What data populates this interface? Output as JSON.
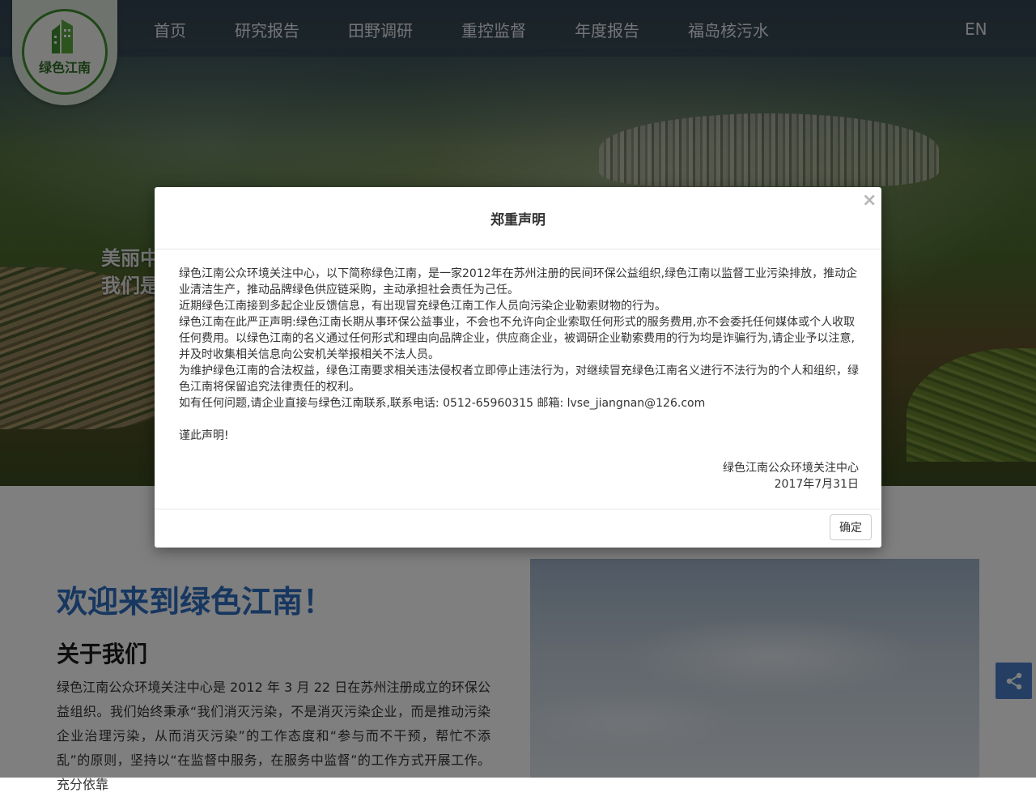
{
  "nav": {
    "logo_text": "绿色江南",
    "items": [
      "首页",
      "研究报告",
      "田野调研",
      "重控监督",
      "年度报告",
      "福岛核污水"
    ],
    "lang": "EN"
  },
  "hero": {
    "caption_line1": "美丽中",
    "caption_line2": "我们是"
  },
  "main": {
    "welcome": "欢迎来到绿色江南！",
    "about_title": "关于我们",
    "about_text": "绿色江南公众环境关注中心是 2012 年 3 月 22 日在苏州注册成立的环保公益组织。我们始终秉承“我们消灭污染，不是消灭污染企业，而是推动污染企业治理污染，从而消灭污染”的工作态度和“参与而不干预，帮忙不添乱”的原则，坚持以“在监督中服务，在服务中监督”的工作方式开展工作。充分依靠"
  },
  "modal": {
    "title": "郑重声明",
    "close": "×",
    "paragraphs": [
      "绿色江南公众环境关注中心，以下简称绿色江南，是一家2012年在苏州注册的民间环保公益组织,绿色江南以监督工业污染排放，推动企业清洁生产，推动品牌绿色供应链采购，主动承担社会责任为己任。",
      "近期绿色江南接到多起企业反馈信息，有出现冒充绿色江南工作人员向污染企业勒索财物的行为。",
      "绿色江南在此严正声明:绿色江南长期从事环保公益事业，不会也不允许向企业索取任何形式的服务费用,亦不会委托任何媒体或个人收取任何费用。以绿色江南的名义通过任何形式和理由向品牌企业，供应商企业，被调研企业勒索费用的行为均是诈骗行为,请企业予以注意,并及时收集相关信息向公安机关举报相关不法人员。",
      "为维护绿色江南的合法权益，绿色江南要求相关违法侵权者立即停止违法行为，对继续冒充绿色江南名义进行不法行为的个人和组织，绿色江南将保留追究法律责任的权利。",
      "如有任何问题,请企业直接与绿色江南联系,联系电话: 0512-65960315 邮箱: lvse_jiangnan@126.com"
    ],
    "closing": "谨此声明!",
    "signature_org": "绿色江南公众环境关注中心",
    "signature_date": "2017年7月31日",
    "ok_label": "确定"
  },
  "colors": {
    "accent_blue": "#2f6fc0",
    "logo_green": "#3f8f2f",
    "share_blue": "#4a7fc9"
  },
  "icons": {
    "share": "share-icon",
    "close": "close-icon"
  }
}
